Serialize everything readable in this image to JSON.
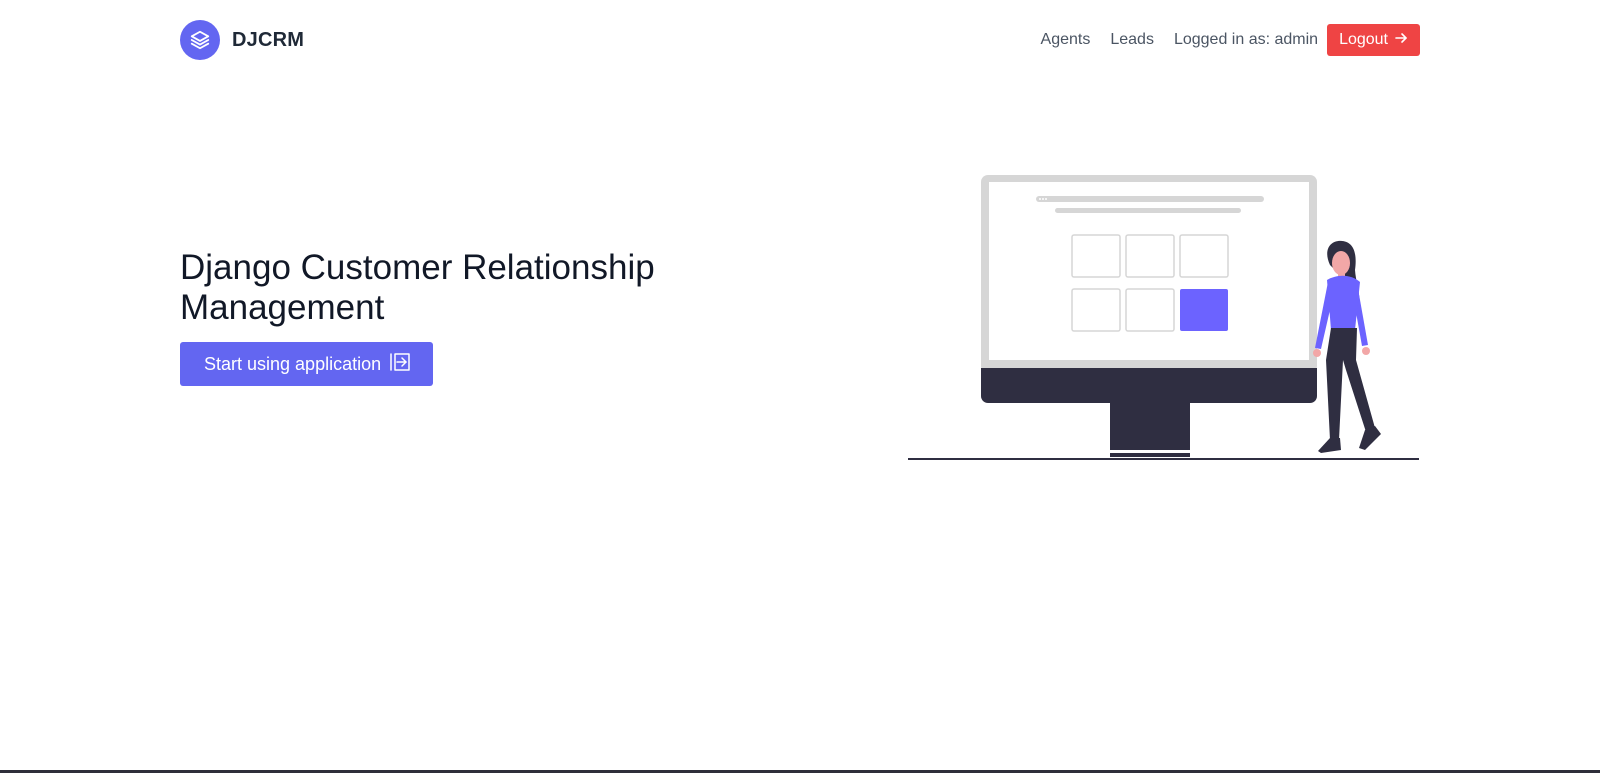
{
  "header": {
    "brand_name": "DJCRM",
    "brand_icon": "layers-icon",
    "nav": {
      "agents": "Agents",
      "leads": "Leads",
      "logged_in_label": "Logged in as:",
      "username": "admin",
      "logout": "Logout"
    }
  },
  "hero": {
    "title": "Django Customer Relationship Management",
    "cta_label": "Start using application"
  },
  "colors": {
    "accent": "#6366f1",
    "danger": "#ef4444",
    "text_dark": "#111827",
    "text_muted": "#4b5563",
    "illustration_dark": "#2f2e41",
    "illustration_highlight": "#6c63ff"
  }
}
